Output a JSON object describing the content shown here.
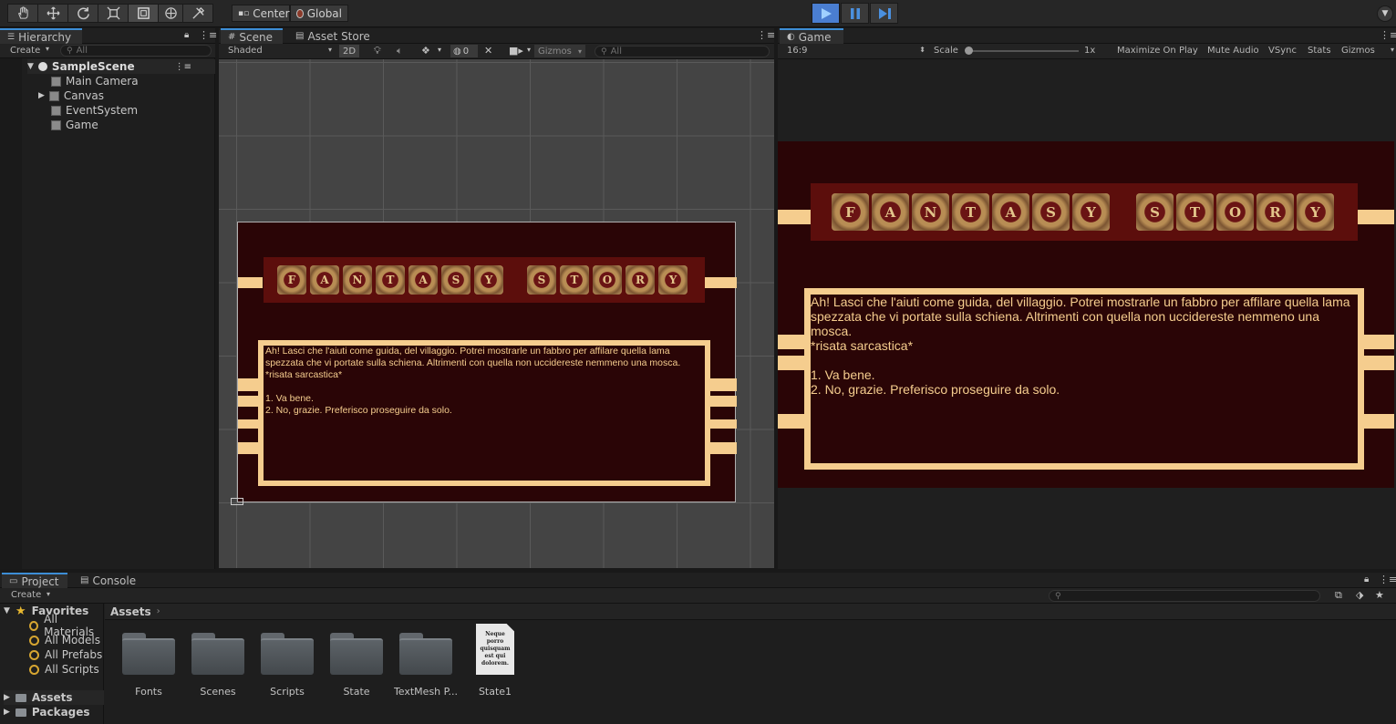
{
  "toolbar": {
    "tools": [
      "hand-tool",
      "move-tool",
      "rotate-tool",
      "scale-tool",
      "rect-tool",
      "transform-tool",
      "custom-tool"
    ],
    "pivot_label": "Center",
    "space_label": "Global"
  },
  "hierarchy": {
    "tab": "Hierarchy",
    "create": "Create",
    "search_placeholder": "All",
    "scene": "SampleScene",
    "items": [
      "Main Camera",
      "Canvas",
      "EventSystem",
      "Game"
    ]
  },
  "scene": {
    "tab": "Scene",
    "asset_store_tab": "Asset Store",
    "shading": "Shaded",
    "mode_2d": "2D",
    "hidden_count": "0",
    "gizmos": "Gizmos",
    "search_placeholder": "All"
  },
  "game": {
    "tab": "Game",
    "aspect": "16:9",
    "scale_label": "Scale",
    "scale_value": "1x",
    "maximize": "Maximize On Play",
    "mute": "Mute Audio",
    "vsync": "VSync",
    "stats": "Stats",
    "gizmos": "Gizmos"
  },
  "title_letters": {
    "word1": [
      "F",
      "A",
      "N",
      "T",
      "A",
      "S",
      "Y"
    ],
    "word2": [
      "S",
      "T",
      "O",
      "R",
      "Y"
    ]
  },
  "dialog": {
    "text": "Ah! Lasci che l'aiuti come guida, del villaggio. Potrei mostrarle un fabbro per affilare quella lama spezzata che vi portate sulla schiena. Altrimenti con quella non uccidereste nemmeno una mosca.\n*risata sarcastica*\n\n1. Va bene.\n2. No, grazie. Preferisco proseguire da solo."
  },
  "project": {
    "tab": "Project",
    "console_tab": "Console",
    "create": "Create",
    "favorites_label": "Favorites",
    "favorites": [
      "All Materials",
      "All Models",
      "All Prefabs",
      "All Scripts"
    ],
    "assets_root": "Assets",
    "packages_root": "Packages",
    "breadcrumb": "Assets",
    "assets": [
      "Fonts",
      "Scenes",
      "Scripts",
      "State",
      "TextMesh P...",
      "State1"
    ],
    "state1_thumb_text": "Neque porro quisquam est qui dolorem."
  },
  "colors": {
    "accent": "#3d8ed6",
    "game_bg": "#2a0506",
    "title_bar": "#5c0e0c",
    "cream": "#f5cd8e"
  }
}
